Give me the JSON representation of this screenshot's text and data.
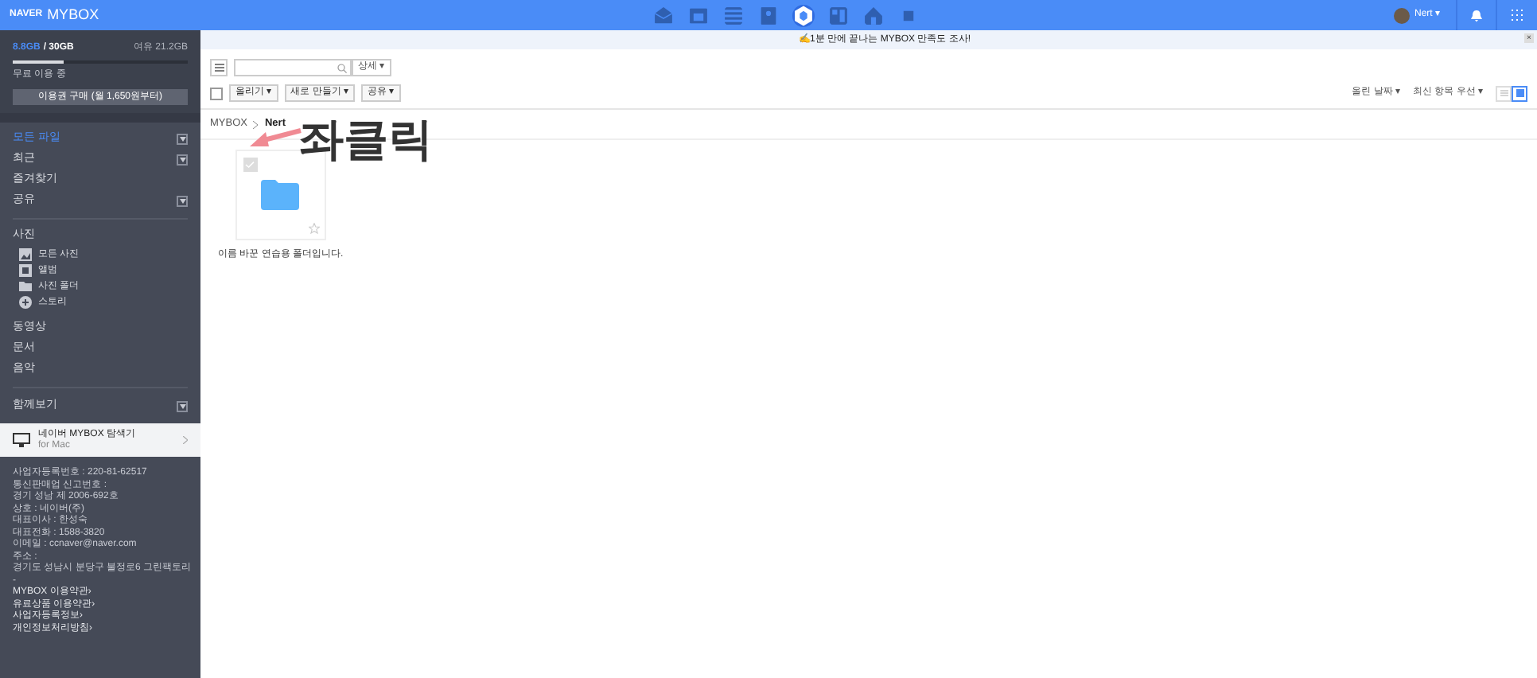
{
  "header": {
    "logo_brand": "NAVER",
    "logo_product": "MYBOX",
    "apps": [
      {
        "kind": "mail",
        "selected": false
      },
      {
        "kind": "calendar",
        "selected": false
      },
      {
        "kind": "list",
        "selected": false
      },
      {
        "kind": "contacts",
        "selected": false
      },
      {
        "kind": "box",
        "selected": true
      },
      {
        "kind": "board",
        "selected": false
      },
      {
        "kind": "home",
        "selected": false
      },
      {
        "kind": "square",
        "selected": false
      }
    ],
    "user": "Nert ▾"
  },
  "storage": {
    "used": "8.8GB",
    "total": "/ 30GB",
    "free": "여유 21.2GB",
    "level": 0.29,
    "plan": "무료 이용 중",
    "buy_button": "이용권 구매 (월 1,650원부터)"
  },
  "nav": [
    {
      "label": "모든 파일",
      "selected": true,
      "expandable": true
    },
    {
      "label": "최근",
      "selected": false,
      "expandable": true
    },
    {
      "label": "즐겨찾기",
      "selected": false,
      "expandable": false
    },
    {
      "label": "공유",
      "selected": false,
      "expandable": true
    }
  ],
  "photos": {
    "title": "사진",
    "items": [
      {
        "label": "모든 사진",
        "kind": "image"
      },
      {
        "label": "앨범",
        "kind": "album"
      },
      {
        "label": "사진 폴더",
        "kind": "folder"
      },
      {
        "label": "스토리",
        "kind": "story"
      }
    ]
  },
  "media": [
    "동영상",
    "문서",
    "음악"
  ],
  "together": {
    "label": "함께보기",
    "expandable": true
  },
  "promo": {
    "title": "네이버 MYBOX 탐색기",
    "subtitle": "for Mac"
  },
  "footer": [
    "사업자등록번호 : 220-81-62517",
    "통신판매업 신고번호 :",
    "경기 성남 제 2006-692호",
    "상호 : 네이버(주)",
    "대표이사 : 한성숙",
    "대표전화 : 1588-3820",
    "이메일 : ccnaver@naver.com",
    "주소 :",
    "경기도 성남시 분당구 불정로6 그린팩토리",
    "-",
    "MYBOX 이용약관›",
    "유료상품 이용약관›",
    "사업자등록정보›",
    "개인정보처리방침›"
  ],
  "banner": {
    "text": "✍1분 만에 끝나는 MYBOX 만족도 조사!",
    "close": "×"
  },
  "toolbar": {
    "detail": "상세 ▾",
    "select_all": false,
    "buttons": [
      "올리기 ▾",
      "새로 만들기 ▾",
      "공유 ▾"
    ],
    "sort": [
      "올린 날짜 ▾",
      "최신 항목 우선 ▾"
    ],
    "views": [
      {
        "kind": "list",
        "selected": false
      },
      {
        "kind": "grid",
        "selected": true
      }
    ]
  },
  "breadcrumb": [
    "MYBOX",
    "Nert"
  ],
  "files": [
    {
      "name": "이름 바꾼 연습용 폴더입니다.",
      "checked": false,
      "favorite": false
    }
  ],
  "annotation": "좌클릭"
}
